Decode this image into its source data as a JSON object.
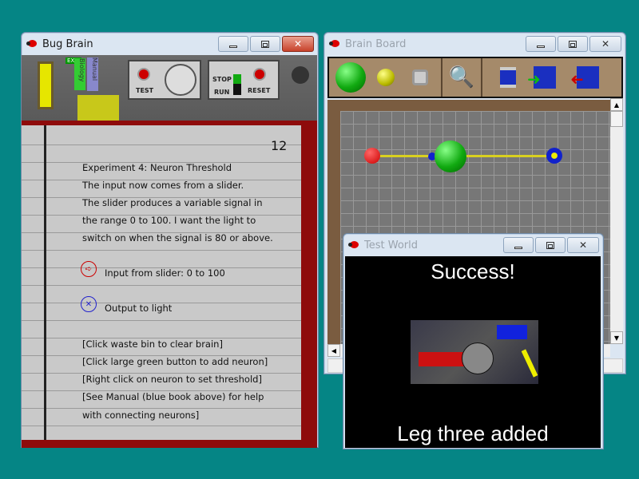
{
  "bug_brain": {
    "title": "Bug Brain",
    "shelf": {
      "exit_sign": "EXIT",
      "book_biology": "Biology",
      "book_manual": "Manual",
      "test_label": "TEST",
      "stop_label": "STOP",
      "run_label": "RUN",
      "reset_label": "RESET"
    },
    "page_number": "12",
    "lines": [
      "Experiment 4: Neuron Threshold",
      "The input now comes from a slider.",
      "The slider produces a variable signal in",
      "the range 0 to 100. I want the light to",
      "switch on when the signal is 80 or above."
    ],
    "input_label": "Input from slider: 0 to 100",
    "output_label": "Output to light",
    "hints": [
      "[Click waste bin to clear brain]",
      "[Click large green button to add neuron]",
      "[Right click on neuron to set threshold]",
      "[See Manual (blue book above) for help",
      "with connecting neurons]"
    ]
  },
  "brain_board": {
    "title": "Brain Board"
  },
  "test_world": {
    "title": "Test World",
    "headline": "Success!",
    "caption": "Leg three added"
  },
  "colors": {
    "desktop": "#058585",
    "neuron": "#1fae1f",
    "input": "#d01010",
    "output": "#1020c0",
    "axon": "#d8d020"
  }
}
